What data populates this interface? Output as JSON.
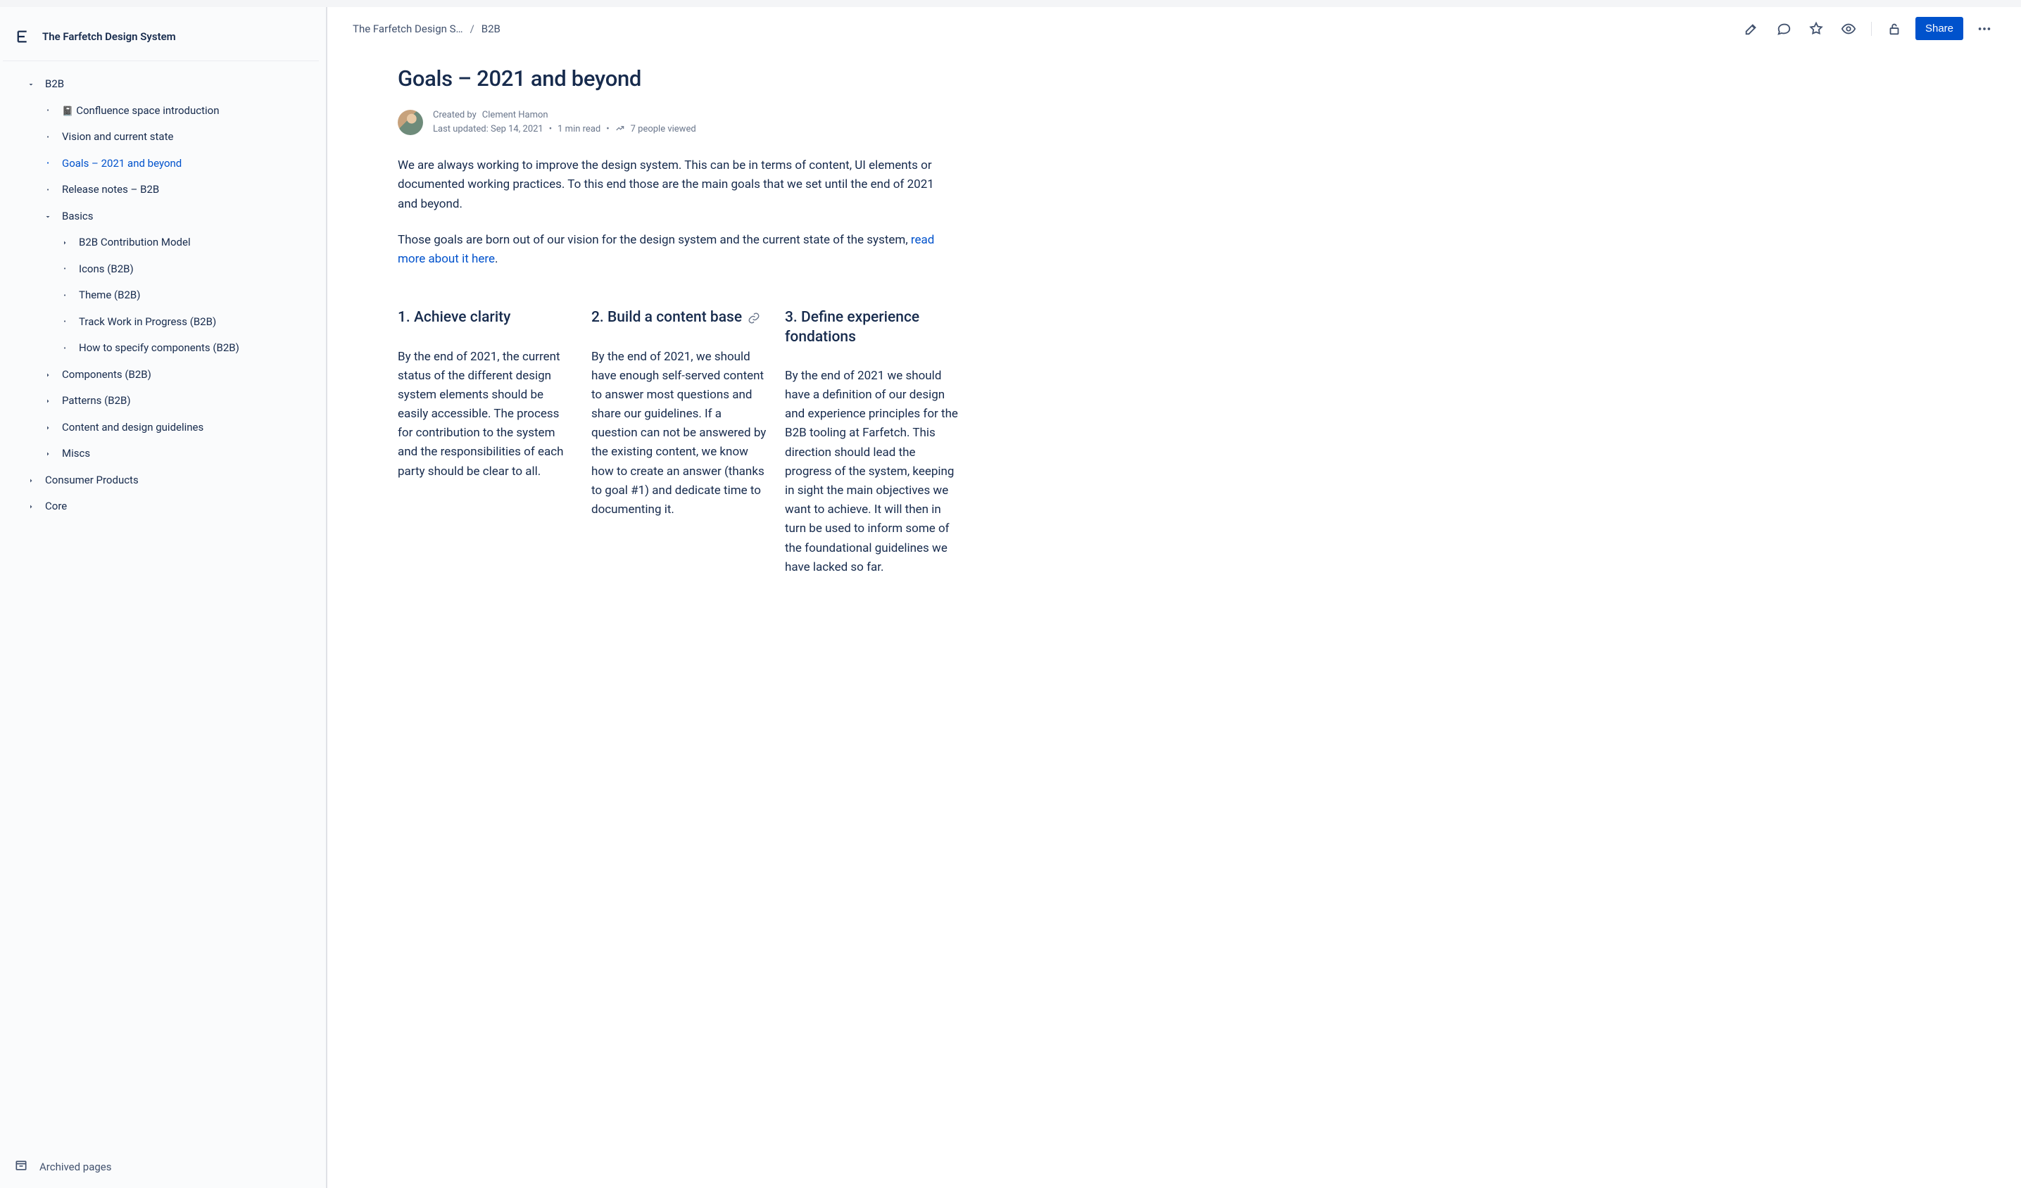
{
  "space": {
    "title": "The Farfetch Design System"
  },
  "sidebar": {
    "tree": [
      {
        "label": "B2B",
        "depth": 0,
        "chev": "down"
      },
      {
        "label": "Confluence space introduction",
        "depth": 1,
        "bullet": true,
        "emoji": "📓"
      },
      {
        "label": "Vision and current state",
        "depth": 1,
        "bullet": true
      },
      {
        "label": "Goals – 2021 and beyond",
        "depth": 1,
        "bullet": true,
        "selected": true
      },
      {
        "label": "Release notes – B2B",
        "depth": 1,
        "bullet": true
      },
      {
        "label": "Basics",
        "depth": 1,
        "chev": "down"
      },
      {
        "label": "B2B Contribution Model",
        "depth": 2,
        "chev": "right"
      },
      {
        "label": "Icons (B2B)",
        "depth": 2,
        "bullet": true
      },
      {
        "label": "Theme (B2B)",
        "depth": 2,
        "bullet": true
      },
      {
        "label": "Track Work in Progress (B2B)",
        "depth": 2,
        "bullet": true
      },
      {
        "label": "How to specify components (B2B)",
        "depth": 2,
        "bullet": true
      },
      {
        "label": "Components (B2B)",
        "depth": 1,
        "chev": "right"
      },
      {
        "label": "Patterns (B2B)",
        "depth": 1,
        "chev": "right"
      },
      {
        "label": "Content and design guidelines",
        "depth": 1,
        "chev": "right"
      },
      {
        "label": "Miscs",
        "depth": 1,
        "chev": "right"
      },
      {
        "label": "Consumer Products",
        "depth": 0,
        "chev": "right"
      },
      {
        "label": "Core",
        "depth": 0,
        "chev": "right"
      }
    ],
    "footer": "Archived pages"
  },
  "breadcrumbs": {
    "0": "The Farfetch Design S…",
    "1": "B2B",
    "sep": "/"
  },
  "actions": {
    "share": "Share"
  },
  "page": {
    "title": "Goals – 2021 and beyond",
    "created_by_prefix": "Created by ",
    "author": "Clement Hamon",
    "updated_prefix": "Last updated: ",
    "updated": "Sep 14, 2021",
    "read_time": "1 min read",
    "views": "7 people viewed",
    "intro": "We are always working to improve the design system. This can be in terms of content, UI elements or documented working practices. To this end those are the main goals that we set until the end of 2021 and beyond.",
    "p2a": "Those goals are born out of our vision for the design system and the current state of the system, ",
    "p2_link": "read more about it here",
    "p2b": ".",
    "cols": [
      {
        "h": "1. Achieve clarity",
        "p": "By the end of 2021, the current status of the different design system elements should be easily accessible. The process for contribution to the system and the responsibilities of each party should be clear to all."
      },
      {
        "h": "2. Build a content base",
        "p": "By the end of 2021, we should have enough self-served content to answer most questions and share our guidelines. If a question can not be answered by the existing content, we know how to create an answer (thanks to goal #1) and dedicate time to documenting it.",
        "linkIcon": true
      },
      {
        "h": "3. Define experience fondations",
        "p": "By the end of 2021 we should have a definition of our design and experience principles for the B2B tooling at Farfetch. This direction should lead the progress of the system, keeping in sight the main objectives we want to achieve. It will then in turn be used to inform some of the foundational guidelines we have lacked so far."
      }
    ]
  }
}
